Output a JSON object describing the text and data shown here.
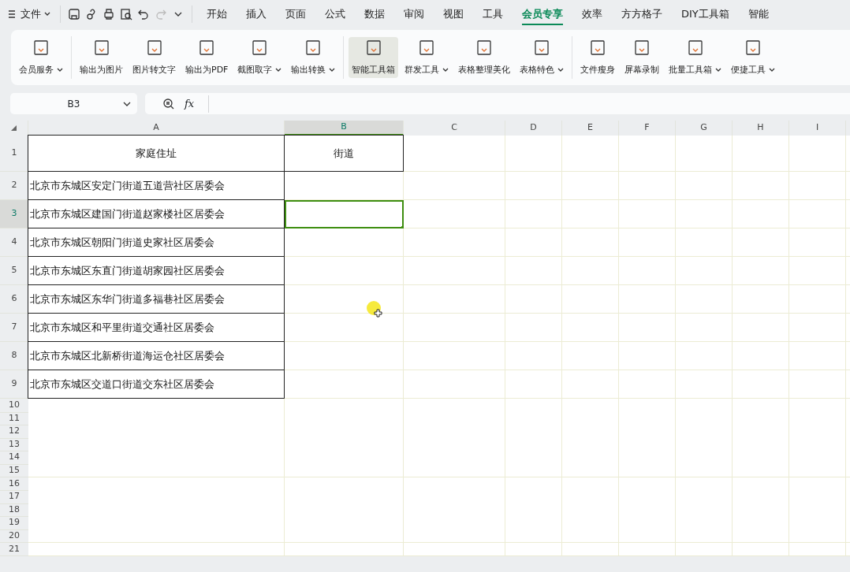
{
  "menu": {
    "file_label": "文件",
    "tabs": [
      {
        "label": "开始",
        "selected": false
      },
      {
        "label": "插入",
        "selected": false
      },
      {
        "label": "页面",
        "selected": false
      },
      {
        "label": "公式",
        "selected": false
      },
      {
        "label": "数据",
        "selected": false
      },
      {
        "label": "审阅",
        "selected": false
      },
      {
        "label": "视图",
        "selected": false
      },
      {
        "label": "工具",
        "selected": false
      },
      {
        "label": "会员专享",
        "selected": true
      },
      {
        "label": "效率",
        "selected": false
      },
      {
        "label": "方方格子",
        "selected": false
      },
      {
        "label": "DIY工具箱",
        "selected": false
      },
      {
        "label": "智能",
        "selected": false
      }
    ]
  },
  "ribbon": {
    "groups": [
      [
        {
          "label": "会员服务",
          "dropdown": true,
          "selected": false
        }
      ],
      [
        {
          "label": "输出为图片",
          "dropdown": false,
          "selected": false
        },
        {
          "label": "图片转文字",
          "dropdown": false,
          "selected": false
        },
        {
          "label": "输出为PDF",
          "dropdown": false,
          "selected": false
        },
        {
          "label": "截图取字",
          "dropdown": true,
          "selected": false
        },
        {
          "label": "输出转换",
          "dropdown": true,
          "selected": false
        }
      ],
      [
        {
          "label": "智能工具箱",
          "dropdown": false,
          "selected": true
        },
        {
          "label": "群发工具",
          "dropdown": true,
          "selected": false
        },
        {
          "label": "表格整理美化",
          "dropdown": false,
          "selected": false
        },
        {
          "label": "表格特色",
          "dropdown": true,
          "selected": false
        }
      ],
      [
        {
          "label": "文件瘦身",
          "dropdown": false,
          "selected": false
        },
        {
          "label": "屏幕录制",
          "dropdown": false,
          "selected": false
        },
        {
          "label": "批量工具箱",
          "dropdown": true,
          "selected": false
        },
        {
          "label": "便捷工具",
          "dropdown": true,
          "selected": false
        }
      ]
    ]
  },
  "name_box": "B3",
  "formula_button": "fx",
  "columns": [
    {
      "label": "A",
      "selected": false
    },
    {
      "label": "B",
      "selected": true
    },
    {
      "label": "C",
      "selected": false
    },
    {
      "label": "D",
      "selected": false
    },
    {
      "label": "E",
      "selected": false
    },
    {
      "label": "F",
      "selected": false
    },
    {
      "label": "G",
      "selected": false
    },
    {
      "label": "H",
      "selected": false
    },
    {
      "label": "I",
      "selected": false
    }
  ],
  "rows": [
    {
      "label": "1",
      "selected": false,
      "cells": [
        {
          "text": "家庭住址",
          "bordered": true,
          "selected": false
        },
        {
          "text": "街道",
          "bordered": true,
          "selected": false
        }
      ]
    },
    {
      "label": "2",
      "selected": false,
      "cells": [
        {
          "text": "北京市东城区安定门街道五道营社区居委会",
          "bordered": true,
          "selected": false
        },
        {
          "text": "",
          "bordered": false,
          "selected": false
        }
      ]
    },
    {
      "label": "3",
      "selected": true,
      "cells": [
        {
          "text": "北京市东城区建国门街道赵家楼社区居委会",
          "bordered": true,
          "selected": false
        },
        {
          "text": "",
          "bordered": false,
          "selected": true
        }
      ]
    },
    {
      "label": "4",
      "selected": false,
      "cells": [
        {
          "text": "北京市东城区朝阳门街道史家社区居委会",
          "bordered": true,
          "selected": false
        },
        {
          "text": "",
          "bordered": false,
          "selected": false
        }
      ]
    },
    {
      "label": "5",
      "selected": false,
      "cells": [
        {
          "text": "北京市东城区东直门街道胡家园社区居委会",
          "bordered": true,
          "selected": false
        },
        {
          "text": "",
          "bordered": false,
          "selected": false
        }
      ]
    },
    {
      "label": "6",
      "selected": false,
      "cells": [
        {
          "text": "北京市东城区东华门街道多福巷社区居委会",
          "bordered": true,
          "selected": false
        },
        {
          "text": "",
          "bordered": false,
          "selected": false
        }
      ]
    },
    {
      "label": "7",
      "selected": false,
      "cells": [
        {
          "text": "北京市东城区和平里街道交通社区居委会",
          "bordered": true,
          "selected": false
        },
        {
          "text": "",
          "bordered": false,
          "selected": false
        }
      ]
    },
    {
      "label": "8",
      "selected": false,
      "cells": [
        {
          "text": "北京市东城区北新桥街道海运仓社区居委会",
          "bordered": true,
          "selected": false
        },
        {
          "text": "",
          "bordered": false,
          "selected": false
        }
      ]
    },
    {
      "label": "9",
      "selected": false,
      "cells": [
        {
          "text": "北京市东城区交道口街道交东社区居委会",
          "bordered": true,
          "selected": false
        },
        {
          "text": "",
          "bordered": false,
          "selected": false
        }
      ]
    }
  ],
  "empty_rows": [
    "10",
    "11",
    "12",
    "13",
    "14",
    "15",
    "16",
    "17",
    "18",
    "19",
    "20",
    "21"
  ]
}
